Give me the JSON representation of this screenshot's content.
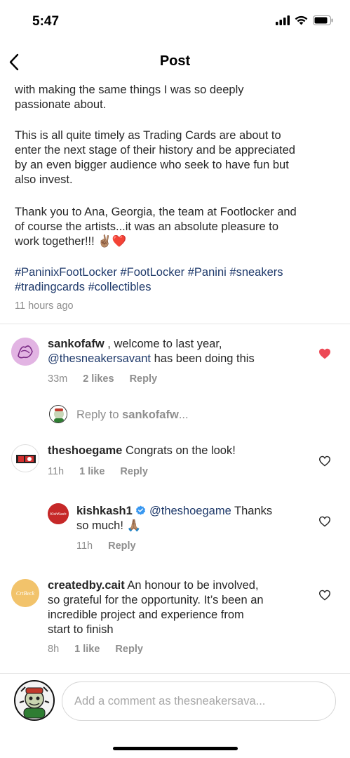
{
  "status": {
    "time": "5:47"
  },
  "nav": {
    "title": "Post"
  },
  "caption": {
    "p1_line1": "with making the same things I was so deeply",
    "p1_line2": "passionate about.",
    "p2_line1": "This is all quite timely as Trading Cards are about to",
    "p2_line2": "enter the next stage of their history and be appreciated",
    "p2_line3": "by an even bigger audience who seek to have fun but",
    "p2_line4": "also invest.",
    "p3_line1": "Thank you to Ana, Georgia, the team at Footlocker and",
    "p3_line2": "of course the artists...it was an absolute pleasure to",
    "p3_line3": "work together!!! ✌🏽❤️"
  },
  "hashtags": [
    "#PaninixFootLocker",
    "#FootLocker",
    "#Panini",
    "#sneakers",
    "#tradingcards",
    "#collectibles"
  ],
  "post_time": "11 hours ago",
  "comments": [
    {
      "username": "sankofafw",
      "text_a": " , welcome to last year,",
      "mention": "@thesneakersavant",
      "text_b": " has been doing this",
      "time": "33m",
      "likes": "2 likes",
      "reply": "Reply",
      "liked": true
    },
    {
      "username": "theshoegame",
      "text": " Congrats on the look!",
      "time": "11h",
      "likes": "1 like",
      "reply": "Reply",
      "liked": false
    },
    {
      "username": "kishkash1",
      "mention": "@theshoegame",
      "text_a": " Thanks",
      "text_b": "so much! 🙏🏽",
      "time": "11h",
      "reply": "Reply",
      "liked": false
    },
    {
      "username": "createdby.cait",
      "line1": " An honour to be involved,",
      "line2": "so grateful for the opportunity. It’s been an",
      "line3": "incredible project and experience from",
      "line4": "start to finish",
      "time": "8h",
      "likes": "1 like",
      "reply": "Reply",
      "liked": false
    }
  ],
  "reply_prompt": {
    "prefix": "Reply to ",
    "username": "sankofafw",
    "suffix": "..."
  },
  "comment_box": {
    "placeholder": "Add a comment as thesneakersava..."
  },
  "colors": {
    "like_red": "#ed4956",
    "link_blue": "#1f3a6b",
    "muted": "#8e8e8e",
    "verified_blue": "#3897f0"
  },
  "avatar_text": {
    "kishkash": "KishKash",
    "createdby": "CrtBeck"
  }
}
